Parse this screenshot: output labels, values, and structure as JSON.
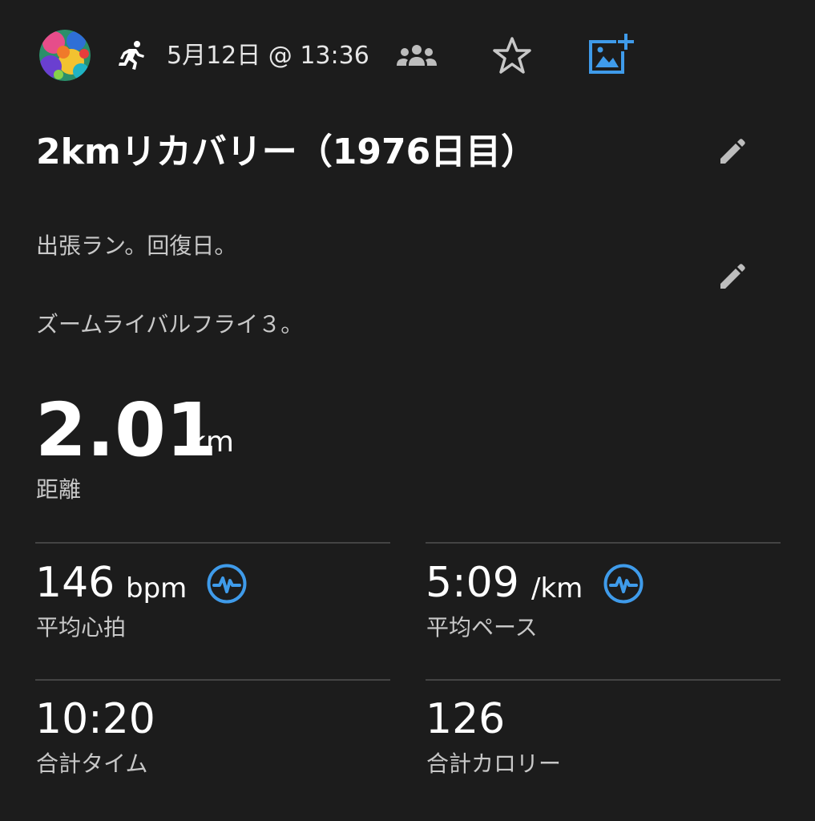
{
  "header": {
    "avatar_icon": "user-avatar",
    "activity_icon": "running-person-icon",
    "date_time": "5月12日 @ 13:36",
    "group_icon": "group-icon",
    "favorite_icon": "star-outline-icon",
    "add_photo_icon": "add-photo-icon",
    "accent_color": "#3f9bea"
  },
  "activity": {
    "title": "2kmリカバリー（1976日目）",
    "edit_icon": "pencil-icon"
  },
  "description": {
    "line1": "出張ラン。回復日。",
    "line2": "ズームライバルフライ３。",
    "edit_icon": "pencil-icon"
  },
  "distance": {
    "value": "2.01",
    "unit": "km",
    "label": "距離"
  },
  "stats": {
    "avg_heart_rate": {
      "value": "146",
      "unit": "bpm",
      "label": "平均心拍",
      "icon": "activity-graph-icon"
    },
    "avg_pace": {
      "value": "5:09",
      "unit": "/km",
      "label": "平均ペース",
      "icon": "activity-graph-icon"
    },
    "total_time": {
      "value": "10:20",
      "label": "合計タイム"
    },
    "total_calories": {
      "value": "126",
      "label": "合計カロリー"
    }
  }
}
